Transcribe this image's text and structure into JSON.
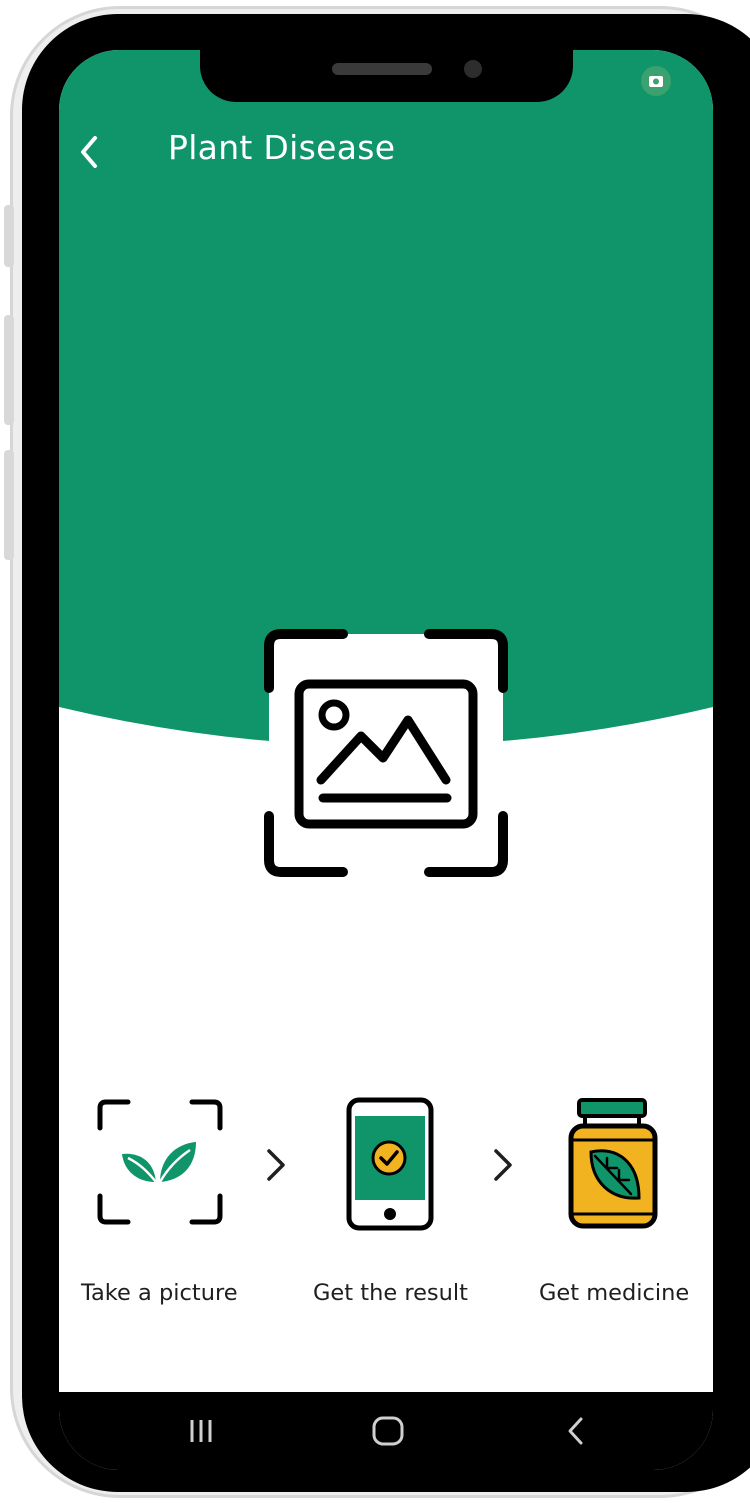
{
  "header": {
    "title": "Plant Disease"
  },
  "colors": {
    "primary_green": "#10956A",
    "icon_yellow": "#F2B320",
    "text_dark": "#1f1f1f",
    "background": "#ffffff"
  },
  "hero": {
    "icon": "image-scan-icon"
  },
  "steps": [
    {
      "label": "Take a picture",
      "icon": "leaf-scan-icon"
    },
    {
      "label": "Get the result",
      "icon": "phone-check-icon"
    },
    {
      "label": "Get medicine",
      "icon": "medicine-jar-icon"
    }
  ],
  "nav_bar": {
    "buttons": [
      "recent-apps-icon",
      "home-icon",
      "back-icon"
    ]
  }
}
